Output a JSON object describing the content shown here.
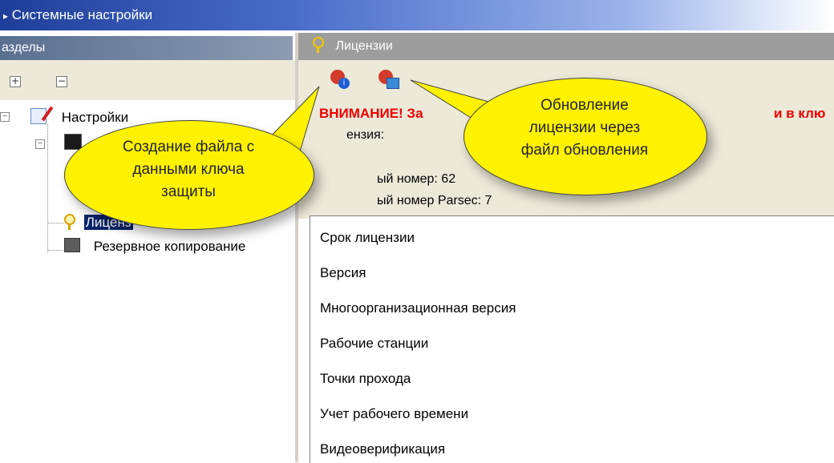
{
  "window": {
    "title": "Системные настройки"
  },
  "left_panel": {
    "header": "азделы",
    "tree": {
      "root": "Настройки",
      "licenses": "Лиценз",
      "backup": "Резервное копирование"
    }
  },
  "right_panel": {
    "header": "Лицензии",
    "warning_left": "ВНИМАНИЕ! За",
    "warning_right": "и в клю",
    "license_label": "ензия:",
    "serial": "ый номер: 62",
    "serial_parsec": "ый номер Parsec: 7"
  },
  "license_items": [
    "Срок лицензии",
    "Версия",
    "Многоорганизационная версия",
    "Рабочие станции",
    "Точки прохода",
    "Учет рабочего времени",
    "Видеоверификация"
  ],
  "callouts": {
    "create_key_file": [
      "Создание файла с",
      "данными ключа",
      "защиты"
    ],
    "update_license": [
      "Обновление",
      "лицензии через",
      "файл обновления"
    ]
  },
  "colors": {
    "title_bar": "#1f3e9a",
    "warning": "#ee0000",
    "callout": "#fff200",
    "selection": "#0a246a"
  },
  "icons": {
    "title": "gear-icon",
    "licenses_header": "key-icon",
    "create_file": "key-info-icon",
    "update": "key-update-icon"
  }
}
